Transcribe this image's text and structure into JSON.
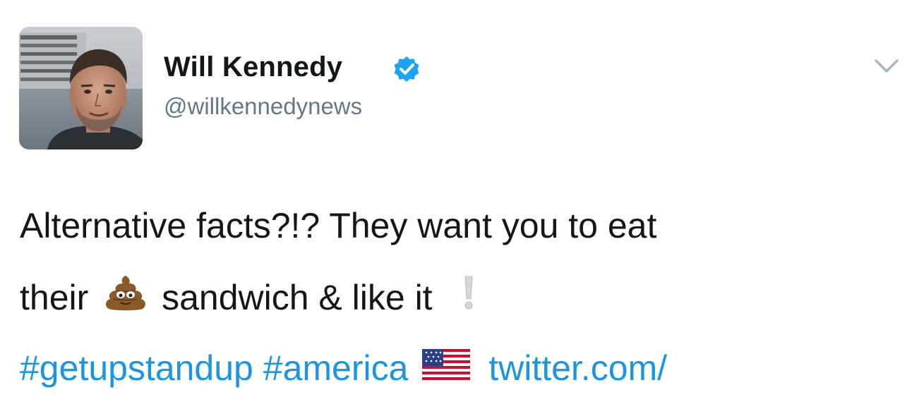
{
  "user": {
    "display_name": "Will Kennedy",
    "handle": "@willkennedynews",
    "verified": true,
    "avatar_icon": "profile-photo"
  },
  "tweet": {
    "line1": "Alternative facts?!? They want you to eat",
    "line2_before": "their",
    "line2_emoji": "pile-of-poo-emoji",
    "line2_middle": "sandwich & like it",
    "line2_emoji2": "white-exclamation-emoji",
    "hashtags": [
      "#getupstandup",
      "#america"
    ],
    "flag_emoji": "us-flag-emoji",
    "link_text": "twitter.com/"
  },
  "menu": {
    "caret_icon": "chevron-down-icon"
  },
  "colors": {
    "text": "#14171a",
    "secondary": "#657786",
    "link": "#1b95e0",
    "verified": "#1da1f2"
  }
}
